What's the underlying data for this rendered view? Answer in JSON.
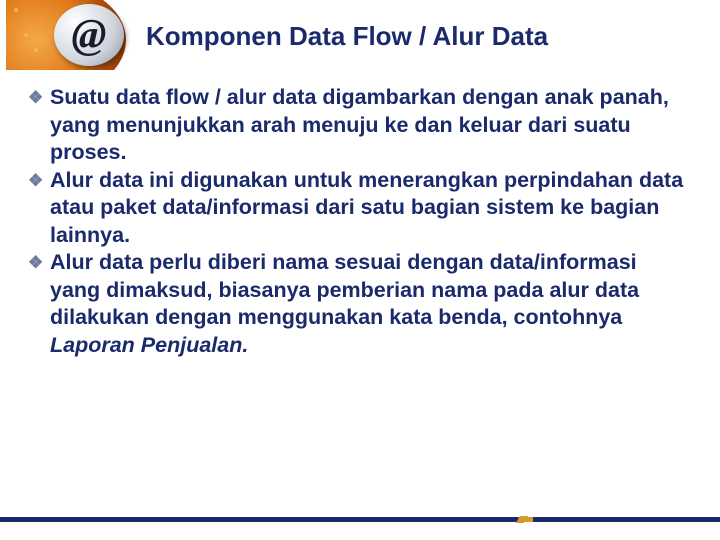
{
  "header": {
    "logo_symbol": "@",
    "title": "Komponen Data Flow / Alur Data"
  },
  "bullets": [
    {
      "text": "Suatu data flow / alur data digambarkan dengan anak panah, yang menunjukkan arah menuju ke dan keluar dari suatu proses."
    },
    {
      "text": "Alur data ini digunakan untuk menerangkan perpindahan data atau paket data/informasi dari satu bagian sistem ke bagian lainnya."
    },
    {
      "text_pre": "Alur data perlu diberi nama sesuai dengan data/informasi yang dimaksud, biasanya pemberian nama pada alur data dilakukan dengan menggunakan kata benda, contohnya ",
      "text_ital": "Laporan Penjualan.",
      "text_post": ""
    }
  ]
}
